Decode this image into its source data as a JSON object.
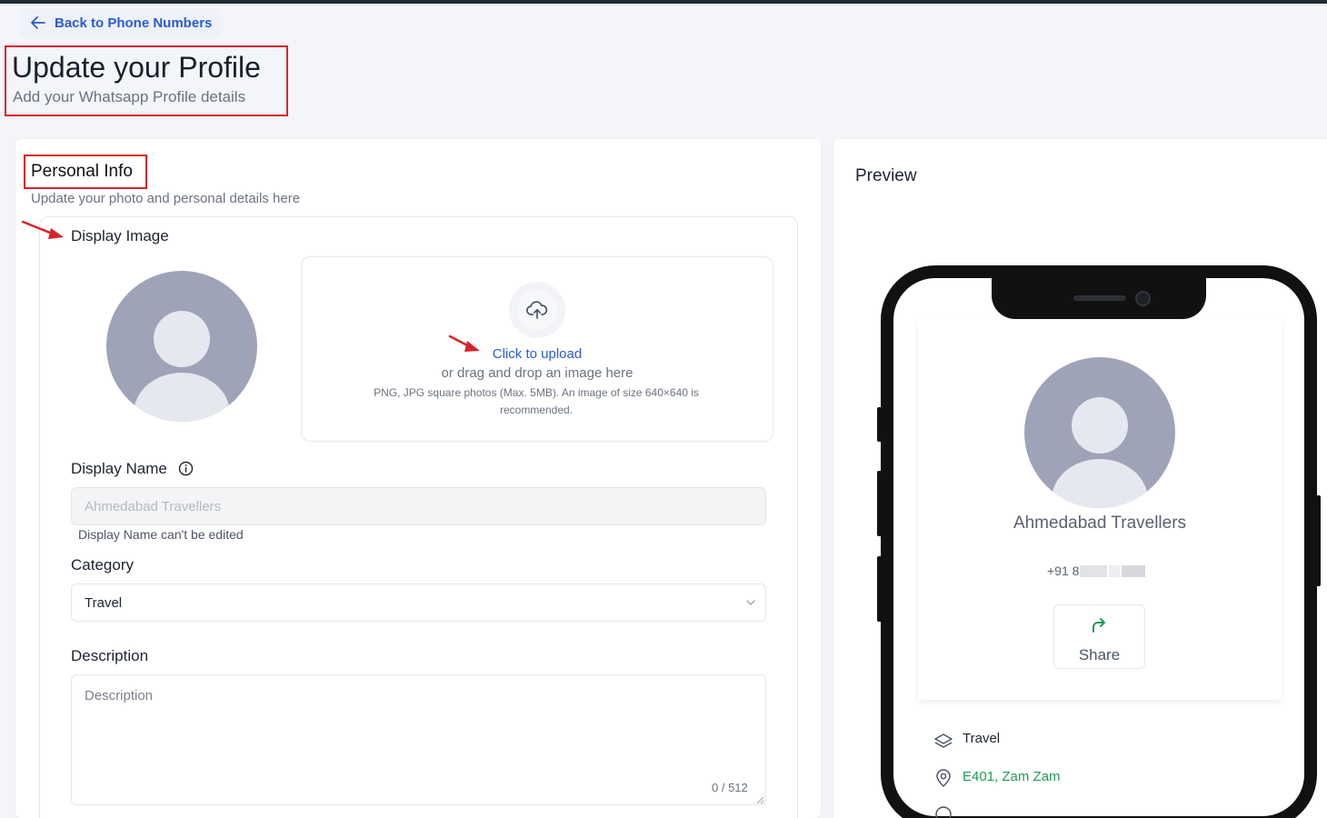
{
  "header": {
    "back_label": "Back to Phone Numbers",
    "title": "Update your Profile",
    "subtitle": "Add your Whatsapp Profile details"
  },
  "personal_info": {
    "title": "Personal Info",
    "subtitle": "Update your photo and personal details here",
    "display_image_label": "Display Image",
    "upload": {
      "link": "Click to upload",
      "drag": "or drag and drop an image here",
      "hint": "PNG, JPG square photos (Max. 5MB). An image of size 640×640 is recommended."
    },
    "display_name": {
      "label": "Display Name",
      "placeholder": "Ahmedabad Travellers",
      "help": "Display Name can't be edited"
    },
    "category": {
      "label": "Category",
      "value": "Travel"
    },
    "description": {
      "label": "Description",
      "placeholder": "Description",
      "counter": "0 / 512"
    }
  },
  "preview": {
    "title": "Preview",
    "name": "Ahmedabad Travellers",
    "phone": "+91 8",
    "share_label": "Share",
    "category": "Travel",
    "address": "E401, Zam Zam",
    "accent_color": "#1f9d55"
  },
  "colors": {
    "annotation_red": "#d8232a",
    "link_blue": "#2a5bd7"
  }
}
